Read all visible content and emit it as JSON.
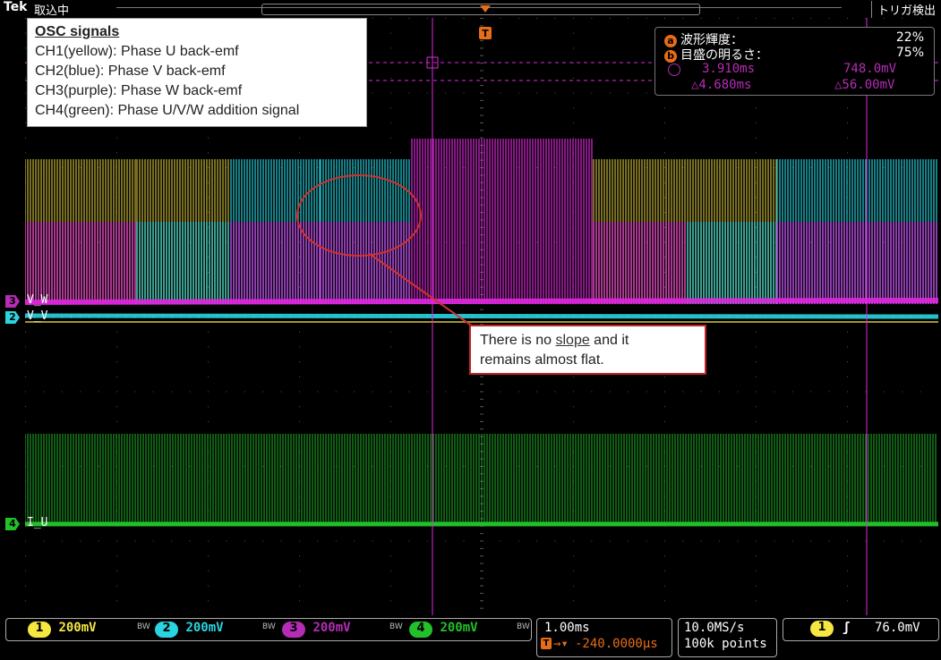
{
  "header": {
    "brand": "Tek",
    "acquisition_state": "取込中",
    "trigger_state": "トリガ検出"
  },
  "note": {
    "title": "OSC signals",
    "lines": [
      "CH1(yellow):  Phase U back-emf",
      "CH2(blue): Phase V back-emf",
      "CH3(purple): Phase W back-emf",
      "CH4(green): Phase U/V/W addition signal"
    ]
  },
  "callout": {
    "prefix": "There is no ",
    "underlined": "slope",
    "suffix": " and it",
    "line2": "remains almost flat."
  },
  "measurement": {
    "a_label": "波形輝度：",
    "a_value": "22%",
    "b_label": "目盛の明るさ：",
    "b_value": "75%",
    "cursor_time": "3.910ms",
    "cursor_volt": "748.0mV",
    "delta_time": "△4.680ms",
    "delta_volt": "△56.00mV"
  },
  "channels": {
    "ch3_label": "V_W",
    "ch2_label": "V_V",
    "ch4_label": "I_U",
    "ch1": {
      "num": "1",
      "scale": "200mV",
      "color": "#f5e642"
    },
    "ch2": {
      "num": "2",
      "scale": "200mV",
      "color": "#2ad4e0"
    },
    "ch3": {
      "num": "3",
      "scale": "200mV",
      "color": "#b52cb5"
    },
    "ch4": {
      "num": "4",
      "scale": "200mV",
      "color": "#22c02a"
    },
    "bw_mark": "BW"
  },
  "horizontal": {
    "scale": "1.00ms",
    "position": "-240.0000µs"
  },
  "acquisition": {
    "rate": "10.0MS/s",
    "length": "100k points"
  },
  "trigger": {
    "source": "1",
    "slope": "ʃ",
    "level": "76.0mV"
  },
  "colors": {
    "yellow": "#c9b93a",
    "cyan": "#2ad4e0",
    "magenta": "#e028e0",
    "green": "#22c02a",
    "grid": "#555555"
  }
}
